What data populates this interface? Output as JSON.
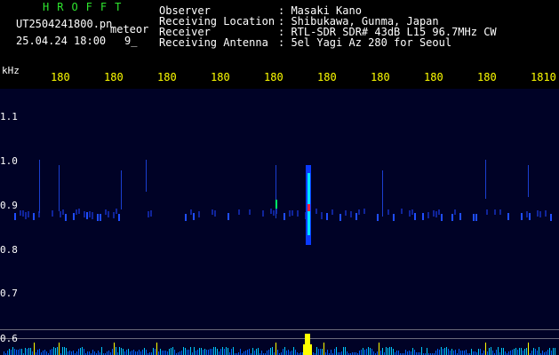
{
  "header": {
    "logo_text": "HROFFT",
    "filename": "UT2504241800.pn",
    "overlay_label": "meteor",
    "datetime": "25.04.24 18:00",
    "count_value": "9_",
    "fields": [
      {
        "label": "Observer",
        "value": ": Masaki Kano"
      },
      {
        "label": "Receiving Location",
        "value": ": Shibukawa, Gunma, Japan"
      },
      {
        "label": "Receiver",
        "value": ": RTL-SDR SDR# 43dB L15 96.7MHz CW"
      },
      {
        "label": "Receiving Antenna",
        "value": ": 5el Yagi Az 280 for Seoul"
      }
    ]
  },
  "y_axis": {
    "unit_label": "kHz",
    "ticks": [
      "1.1",
      "1.0",
      "0.9",
      "0.8",
      "0.7",
      "0.6"
    ]
  },
  "x_axis": {
    "ticks": [
      "180",
      "180",
      "180",
      "180",
      "180",
      "180",
      "180",
      "180",
      "180",
      "1810"
    ]
  },
  "colors": {
    "background": "#000000",
    "plot_bg": "#000226",
    "header_green": "#2ee62e",
    "axis_yellow": "#ffff00",
    "signal_cyan": "#00e5ff",
    "signal_red": "#ff2040"
  }
}
